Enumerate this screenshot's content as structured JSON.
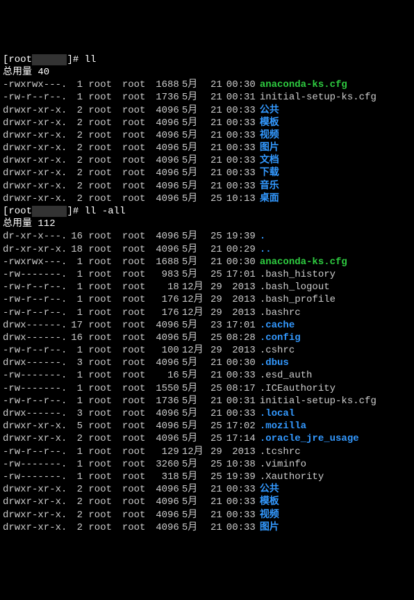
{
  "prompt1": {
    "pre": "[root",
    "redacted": "      ",
    "post": "]# ",
    "cmd": "ll"
  },
  "total1_label": "总用量 40",
  "listing1": [
    {
      "perms": "-rwxrwx---.",
      "links": "1",
      "owner": "root",
      "group": "root",
      "size": "1688",
      "month": "5月",
      "day": "21",
      "time": "00:30",
      "name": "anaconda-ks.cfg",
      "color": "c-green"
    },
    {
      "perms": "-rw-r--r--.",
      "links": "1",
      "owner": "root",
      "group": "root",
      "size": "1736",
      "month": "5月",
      "day": "21",
      "time": "00:31",
      "name": "initial-setup-ks.cfg",
      "color": "c-default"
    },
    {
      "perms": "drwxr-xr-x.",
      "links": "2",
      "owner": "root",
      "group": "root",
      "size": "4096",
      "month": "5月",
      "day": "21",
      "time": "00:33",
      "name": "公共",
      "color": "c-blue"
    },
    {
      "perms": "drwxr-xr-x.",
      "links": "2",
      "owner": "root",
      "group": "root",
      "size": "4096",
      "month": "5月",
      "day": "21",
      "time": "00:33",
      "name": "模板",
      "color": "c-blue"
    },
    {
      "perms": "drwxr-xr-x.",
      "links": "2",
      "owner": "root",
      "group": "root",
      "size": "4096",
      "month": "5月",
      "day": "21",
      "time": "00:33",
      "name": "视频",
      "color": "c-blue"
    },
    {
      "perms": "drwxr-xr-x.",
      "links": "2",
      "owner": "root",
      "group": "root",
      "size": "4096",
      "month": "5月",
      "day": "21",
      "time": "00:33",
      "name": "图片",
      "color": "c-blue"
    },
    {
      "perms": "drwxr-xr-x.",
      "links": "2",
      "owner": "root",
      "group": "root",
      "size": "4096",
      "month": "5月",
      "day": "21",
      "time": "00:33",
      "name": "文档",
      "color": "c-blue"
    },
    {
      "perms": "drwxr-xr-x.",
      "links": "2",
      "owner": "root",
      "group": "root",
      "size": "4096",
      "month": "5月",
      "day": "21",
      "time": "00:33",
      "name": "下载",
      "color": "c-blue"
    },
    {
      "perms": "drwxr-xr-x.",
      "links": "2",
      "owner": "root",
      "group": "root",
      "size": "4096",
      "month": "5月",
      "day": "21",
      "time": "00:33",
      "name": "音乐",
      "color": "c-blue"
    },
    {
      "perms": "drwxr-xr-x.",
      "links": "2",
      "owner": "root",
      "group": "root",
      "size": "4096",
      "month": "5月",
      "day": "25",
      "time": "10:13",
      "name": "桌面",
      "color": "c-blue"
    }
  ],
  "prompt2": {
    "pre": "[root",
    "redacted": "      ",
    "post": "]# ",
    "cmd": "ll -all"
  },
  "total2_label": "总用量 112",
  "listing2": [
    {
      "perms": "dr-xr-x---.",
      "links": "16",
      "owner": "root",
      "group": "root",
      "size": "4096",
      "month": "5月",
      "day": "25",
      "time": "19:39",
      "name": ".",
      "color": "c-blue"
    },
    {
      "perms": "dr-xr-xr-x.",
      "links": "18",
      "owner": "root",
      "group": "root",
      "size": "4096",
      "month": "5月",
      "day": "21",
      "time": "00:29",
      "name": "..",
      "color": "c-blue"
    },
    {
      "perms": "-rwxrwx---.",
      "links": "1",
      "owner": "root",
      "group": "root",
      "size": "1688",
      "month": "5月",
      "day": "21",
      "time": "00:30",
      "name": "anaconda-ks.cfg",
      "color": "c-green"
    },
    {
      "perms": "-rw-------.",
      "links": "1",
      "owner": "root",
      "group": "root",
      "size": "983",
      "month": "5月",
      "day": "25",
      "time": "17:01",
      "name": ".bash_history",
      "color": "c-default"
    },
    {
      "perms": "-rw-r--r--.",
      "links": "1",
      "owner": "root",
      "group": "root",
      "size": "18",
      "month": "12月",
      "day": "29",
      "time": "2013",
      "name": ".bash_logout",
      "color": "c-default"
    },
    {
      "perms": "-rw-r--r--.",
      "links": "1",
      "owner": "root",
      "group": "root",
      "size": "176",
      "month": "12月",
      "day": "29",
      "time": "2013",
      "name": ".bash_profile",
      "color": "c-default"
    },
    {
      "perms": "-rw-r--r--.",
      "links": "1",
      "owner": "root",
      "group": "root",
      "size": "176",
      "month": "12月",
      "day": "29",
      "time": "2013",
      "name": ".bashrc",
      "color": "c-default"
    },
    {
      "perms": "drwx------.",
      "links": "17",
      "owner": "root",
      "group": "root",
      "size": "4096",
      "month": "5月",
      "day": "23",
      "time": "17:01",
      "name": ".cache",
      "color": "c-blue"
    },
    {
      "perms": "drwx------.",
      "links": "16",
      "owner": "root",
      "group": "root",
      "size": "4096",
      "month": "5月",
      "day": "25",
      "time": "08:28",
      "name": ".config",
      "color": "c-blue"
    },
    {
      "perms": "-rw-r--r--.",
      "links": "1",
      "owner": "root",
      "group": "root",
      "size": "100",
      "month": "12月",
      "day": "29",
      "time": "2013",
      "name": ".cshrc",
      "color": "c-default"
    },
    {
      "perms": "drwx------.",
      "links": "3",
      "owner": "root",
      "group": "root",
      "size": "4096",
      "month": "5月",
      "day": "21",
      "time": "00:30",
      "name": ".dbus",
      "color": "c-blue"
    },
    {
      "perms": "-rw-------.",
      "links": "1",
      "owner": "root",
      "group": "root",
      "size": "16",
      "month": "5月",
      "day": "21",
      "time": "00:33",
      "name": ".esd_auth",
      "color": "c-default"
    },
    {
      "perms": "-rw-------.",
      "links": "1",
      "owner": "root",
      "group": "root",
      "size": "1550",
      "month": "5月",
      "day": "25",
      "time": "08:17",
      "name": ".ICEauthority",
      "color": "c-default"
    },
    {
      "perms": "-rw-r--r--.",
      "links": "1",
      "owner": "root",
      "group": "root",
      "size": "1736",
      "month": "5月",
      "day": "21",
      "time": "00:31",
      "name": "initial-setup-ks.cfg",
      "color": "c-default"
    },
    {
      "perms": "drwx------.",
      "links": "3",
      "owner": "root",
      "group": "root",
      "size": "4096",
      "month": "5月",
      "day": "21",
      "time": "00:33",
      "name": ".local",
      "color": "c-blue"
    },
    {
      "perms": "drwxr-xr-x.",
      "links": "5",
      "owner": "root",
      "group": "root",
      "size": "4096",
      "month": "5月",
      "day": "25",
      "time": "17:02",
      "name": ".mozilla",
      "color": "c-blue"
    },
    {
      "perms": "drwxr-xr-x.",
      "links": "2",
      "owner": "root",
      "group": "root",
      "size": "4096",
      "month": "5月",
      "day": "25",
      "time": "17:14",
      "name": ".oracle_jre_usage",
      "color": "c-blue"
    },
    {
      "perms": "-rw-r--r--.",
      "links": "1",
      "owner": "root",
      "group": "root",
      "size": "129",
      "month": "12月",
      "day": "29",
      "time": "2013",
      "name": ".tcshrc",
      "color": "c-default"
    },
    {
      "perms": "-rw-------.",
      "links": "1",
      "owner": "root",
      "group": "root",
      "size": "3260",
      "month": "5月",
      "day": "25",
      "time": "10:38",
      "name": ".viminfo",
      "color": "c-default"
    },
    {
      "perms": "-rw-------.",
      "links": "1",
      "owner": "root",
      "group": "root",
      "size": "318",
      "month": "5月",
      "day": "25",
      "time": "19:39",
      "name": ".Xauthority",
      "color": "c-default"
    },
    {
      "perms": "drwxr-xr-x.",
      "links": "2",
      "owner": "root",
      "group": "root",
      "size": "4096",
      "month": "5月",
      "day": "21",
      "time": "00:33",
      "name": "公共",
      "color": "c-blue"
    },
    {
      "perms": "drwxr-xr-x.",
      "links": "2",
      "owner": "root",
      "group": "root",
      "size": "4096",
      "month": "5月",
      "day": "21",
      "time": "00:33",
      "name": "模板",
      "color": "c-blue"
    },
    {
      "perms": "drwxr-xr-x.",
      "links": "2",
      "owner": "root",
      "group": "root",
      "size": "4096",
      "month": "5月",
      "day": "21",
      "time": "00:33",
      "name": "视频",
      "color": "c-blue"
    },
    {
      "perms": "drwxr-xr-x.",
      "links": "2",
      "owner": "root",
      "group": "root",
      "size": "4096",
      "month": "5月",
      "day": "21",
      "time": "00:33",
      "name": "图片",
      "color": "c-blue"
    }
  ]
}
